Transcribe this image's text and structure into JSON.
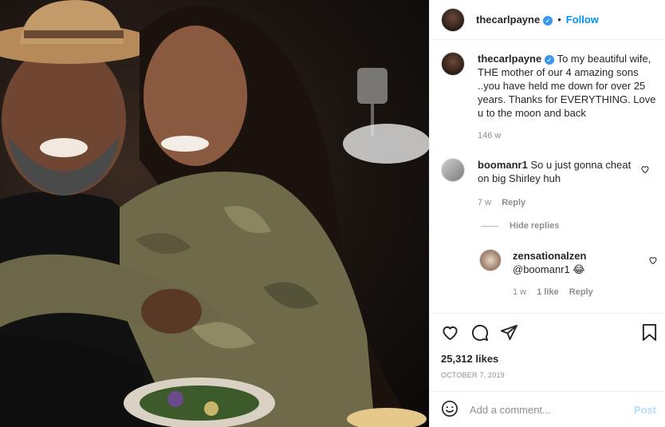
{
  "header": {
    "username": "thecarlpayne",
    "separator": "•",
    "follow_label": "Follow"
  },
  "caption": {
    "username": "thecarlpayne",
    "text": "To my beautiful wife, THE mother of our 4 amazing sons ..you have held me down for over 25 years. Thanks for EVERYTHING. Love u to the moon and back",
    "time": "146 w"
  },
  "comments": [
    {
      "username": "boomanr1",
      "text": "So u just gonna cheat on big Shirley huh",
      "time": "7 w",
      "reply_label": "Reply"
    }
  ],
  "hide_replies_label": "Hide replies",
  "replies": [
    {
      "username": "zensationalzen",
      "text": "@boomanr1 😂",
      "time": "1 w",
      "likes": "1 like",
      "reply_label": "Reply"
    }
  ],
  "actions": {
    "likes": "25,312 likes",
    "date": "OCTOBER 7, 2019"
  },
  "add_comment": {
    "placeholder": "Add a comment...",
    "post_label": "Post"
  },
  "icons": {
    "like": "heart-icon",
    "comment": "comment-icon",
    "share": "share-icon",
    "save": "bookmark-icon",
    "emoji": "emoji-icon"
  },
  "colors": {
    "accent": "#0095f6",
    "verified": "#3897f0",
    "muted": "#8e8e8e",
    "post_disabled": "#b2dffc"
  }
}
